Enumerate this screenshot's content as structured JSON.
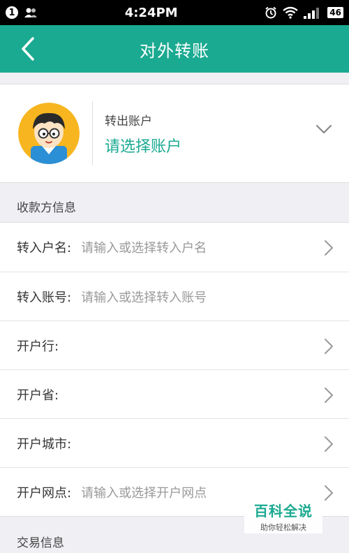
{
  "status_bar": {
    "badge": "1",
    "time": "4:24PM",
    "network": "46"
  },
  "header": {
    "title": "对外转账"
  },
  "account": {
    "label": "转出账户",
    "value": "请选择账户"
  },
  "payee_section": {
    "title": "收款方信息",
    "rows": [
      {
        "label": "转入户名:",
        "placeholder": "请输入或选择转入户名"
      },
      {
        "label": "转入账号:",
        "placeholder": "请输入或选择转入账号"
      },
      {
        "label": "开户行:",
        "placeholder": ""
      },
      {
        "label": "开户省:",
        "placeholder": ""
      },
      {
        "label": "开户城市:",
        "placeholder": ""
      },
      {
        "label": "开户网点:",
        "placeholder": "请输入或选择开户网点"
      }
    ]
  },
  "transaction_section": {
    "title": "交易信息"
  },
  "watermark": {
    "logo": "百科全说",
    "slogan": "助你轻松解决"
  },
  "colors": {
    "accent": "#1aaa91",
    "background": "#efeff4"
  }
}
